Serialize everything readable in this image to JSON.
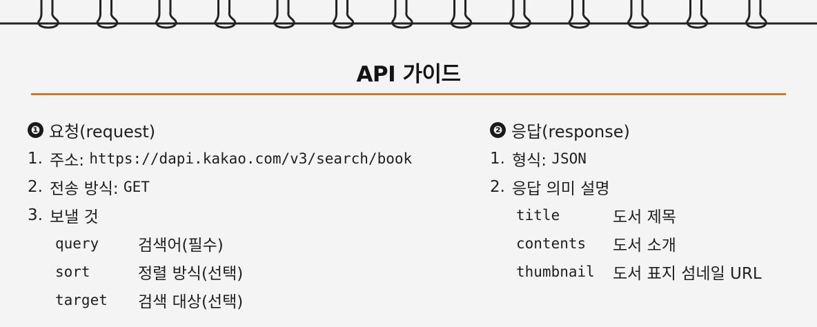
{
  "page": {
    "title": "API 가이드",
    "accent_color": "#c97a33"
  },
  "request": {
    "bullet": "❶",
    "heading": "요청(request)",
    "items": [
      {
        "num": "1.",
        "label": "주소:",
        "value": "https://dapi.kakao.com/v3/search/book"
      },
      {
        "num": "2.",
        "label": "전송 방식:",
        "value": "GET"
      },
      {
        "num": "3.",
        "label": "보낼 것"
      }
    ],
    "params": [
      {
        "key": "query",
        "desc": "검색어(필수)"
      },
      {
        "key": "sort",
        "desc": "정렬 방식(선택)"
      },
      {
        "key": "target",
        "desc": "검색 대상(선택)"
      }
    ]
  },
  "response": {
    "bullet": "❷",
    "heading": "응답(response)",
    "items": [
      {
        "num": "1.",
        "label": "형식:",
        "value": "JSON"
      },
      {
        "num": "2.",
        "label": "응답 의미 설명"
      }
    ],
    "fields": [
      {
        "key": "title",
        "desc": "도서 제목"
      },
      {
        "key": "contents",
        "desc": "도서 소개"
      },
      {
        "key": "thumbnail",
        "desc": "도서 표지 섬네일 URL"
      }
    ]
  }
}
